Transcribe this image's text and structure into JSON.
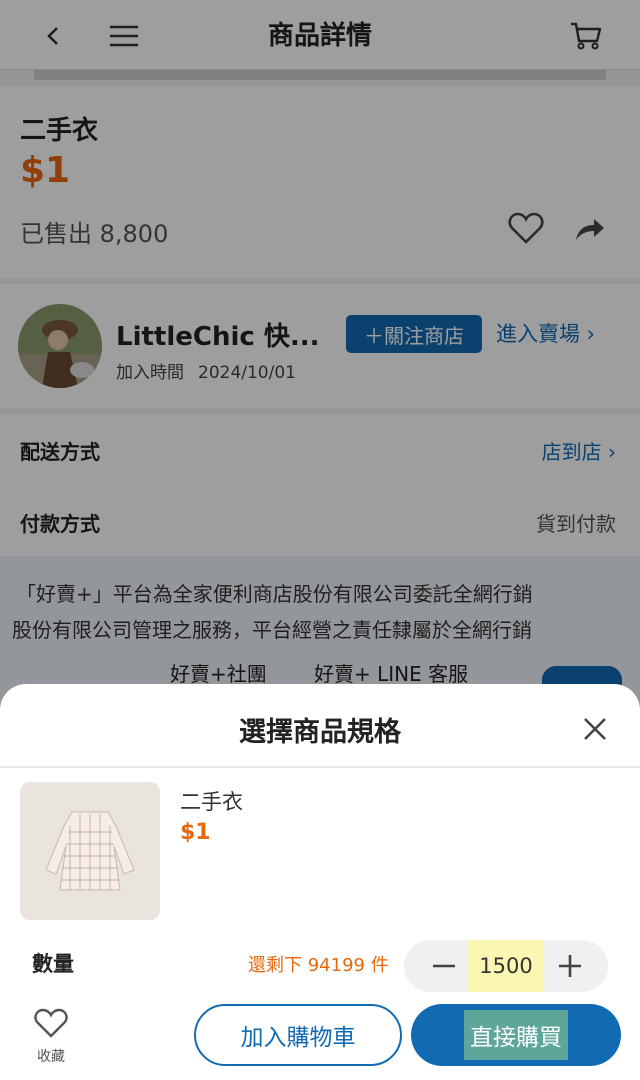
{
  "header": {
    "title": "商品詳情",
    "back_icon": "chevron-left-icon",
    "menu_icon": "hamburger-menu-icon",
    "cart_icon": "cart-icon"
  },
  "product": {
    "name": "二手衣",
    "price": "$1",
    "sold": "已售出 8,800",
    "favorite_icon": "heart-outline-icon",
    "share_icon": "share-arrow-icon"
  },
  "seller": {
    "name": "LittleChic 快...",
    "join_label": "加入時間",
    "join_date": "2024/10/01",
    "follow_label": "＋關注商店",
    "enter_label": "進入賣場 ›"
  },
  "shipping": {
    "label": "配送方式",
    "value": "店到店 ›"
  },
  "payment": {
    "label": "付款方式",
    "value": "貨到付款"
  },
  "footer": {
    "line1": "「好賣+」平台為全家便利商店股份有限公司委託全網行銷",
    "line2": "股份有限公司管理之服務，平台經營之責任隸屬於全網行銷",
    "link1": "好賣+社團",
    "link2": "好賣+ LINE 客服"
  },
  "sheet": {
    "title": "選擇商品規格",
    "close_icon": "close-x-icon",
    "item_name": "二手衣",
    "item_price": "$1",
    "qty_label": "數量",
    "stock": "還剩下 94199 件",
    "qty_value": "1500",
    "collect_label": "收藏",
    "add_cart_label": "加入購物車",
    "buy_now_label": "直接購買"
  },
  "colors": {
    "primary": "#126ab3",
    "price": "#e8680c",
    "highlight": "#fbf7b3",
    "buy_highlight": "#5fa69a"
  }
}
